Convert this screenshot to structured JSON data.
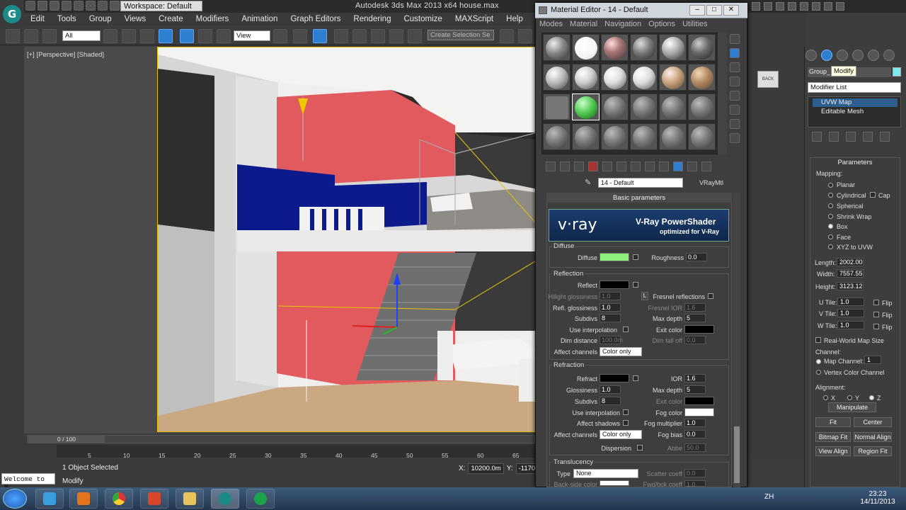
{
  "app": {
    "title": "Autodesk 3ds Max  2013 x64     house.max",
    "workspace": "Workspace: Default"
  },
  "menu": [
    "Edit",
    "Tools",
    "Group",
    "Views",
    "Create",
    "Modifiers",
    "Animation",
    "Graph Editors",
    "Rendering",
    "Customize",
    "MAXScript",
    "Help"
  ],
  "toolbar": {
    "filter": "All",
    "refcoord": "View",
    "named_sel": "Create Selection Se"
  },
  "viewport": {
    "label": "[+] [Perspective] [Shaded]"
  },
  "timeline": {
    "position": "0 / 100",
    "ticks": [
      "5",
      "10",
      "15",
      "20",
      "25",
      "30",
      "35",
      "40",
      "45",
      "50",
      "55",
      "60",
      "65"
    ],
    "end_tick": "100"
  },
  "status": {
    "welcome": "Welcome to M",
    "selection": "1 Object Selected",
    "prompt": "Modify",
    "x_label": "X:",
    "x_value": "10200.0m",
    "y_label": "Y:",
    "y_value": "-11700."
  },
  "taskbar": {
    "lang": "ZH",
    "time": "23:23",
    "date": "14/11/2013"
  },
  "material_editor": {
    "title": "Material Editor - 14 - Default",
    "menu": [
      "Modes",
      "Material",
      "Navigation",
      "Options",
      "Utilities"
    ],
    "material_name": "14 - Default",
    "material_type": "VRayMtl",
    "rollout": "Basic parameters",
    "banner": {
      "logo": "v·ray",
      "heading": "V-Ray PowerShader",
      "sub": "optimized for V-Ray"
    },
    "diffuse": {
      "group": "Diffuse",
      "label": "Diffuse",
      "color": "#8cf07a",
      "roughness_label": "Roughness",
      "roughness": "0.0"
    },
    "reflection": {
      "group": "Reflection",
      "reflect": "Reflect",
      "hilight_label": "Hilight glossiness",
      "hilight": "1.0",
      "lock": "L",
      "fresnel": "Fresnel reflections",
      "refl_gloss_label": "Refl. glossiness",
      "refl_gloss": "1.0",
      "fresnel_ior_label": "Fresnel IOR",
      "fresnel_ior": "1.6",
      "subdivs_label": "Subdivs",
      "subdivs": "8",
      "maxdepth_label": "Max depth",
      "maxdepth": "5",
      "interp": "Use interpolation",
      "exit_label": "Exit color",
      "dim_label": "Dim distance",
      "dim": "100.0m",
      "dimfall_label": "Dim fall off",
      "dimfall": "0.0",
      "affect_label": "Affect channels",
      "affect": "Color only"
    },
    "refraction": {
      "group": "Refraction",
      "refract": "Refract",
      "ior_label": "IOR",
      "ior": "1.6",
      "gloss_label": "Glossiness",
      "gloss": "1.0",
      "maxdepth_label": "Max depth",
      "maxdepth": "5",
      "subdivs_label": "Subdivs",
      "subdivs": "8",
      "exit_label": "Exit color",
      "interp": "Use interpolation",
      "fog_label": "Fog color",
      "shadows": "Affect shadows",
      "fogmult_label": "Fog multiplier",
      "fogmult": "1.0",
      "affect_label": "Affect channels",
      "affect": "Color only",
      "fogbias_label": "Fog bias",
      "fogbias": "0.0",
      "disp": "Dispersion",
      "abbe_label": "Abbe",
      "abbe": "50.0"
    },
    "translucency": {
      "group": "Translucency",
      "type_label": "Type",
      "type": "None",
      "scatter_label": "Scatter coeff",
      "scatter": "0.0",
      "backside_label": "Back-side color",
      "fwdbck_label": "Fwd/bck coeff",
      "fwdbck": "1.0"
    }
  },
  "command_panel": {
    "tooltip": "Modify",
    "object_name": "Group_",
    "object_color": "#7ee8f0",
    "modifier_list": "Modifier List",
    "stack": [
      "UVW Map",
      "Editable Mesh"
    ],
    "params_title": "Parameters",
    "mapping_label": "Mapping:",
    "mapping": [
      "Planar",
      "Cylindrical",
      "Spherical",
      "Shrink Wrap",
      "Box",
      "Face",
      "XYZ to UVW"
    ],
    "cap": "Cap",
    "length_label": "Length:",
    "length": "2002.00",
    "width_label": "Width:",
    "width": "7557.55",
    "height_label": "Height:",
    "height": "3123.12",
    "utile_label": "U Tile:",
    "utile": "1.0",
    "vtile_label": "V Tile:",
    "vtile": "1.0",
    "wtile_label": "W Tile:",
    "wtile": "1.0",
    "flip": "Flip",
    "realworld": "Real-World Map Size",
    "channel_label": "Channel:",
    "map_channel_label": "Map Channel:",
    "map_channel": "1",
    "vertex_channel": "Vertex Color Channel",
    "alignment_label": "Alignment:",
    "axes": [
      "X",
      "Y",
      "Z"
    ],
    "manipulate": "Manipulate",
    "fit": "Fit",
    "center": "Center",
    "bitmap_fit": "Bitmap Fit",
    "normal_align": "Normal Align",
    "view_align": "View Align",
    "region_fit": "Region Fit"
  }
}
